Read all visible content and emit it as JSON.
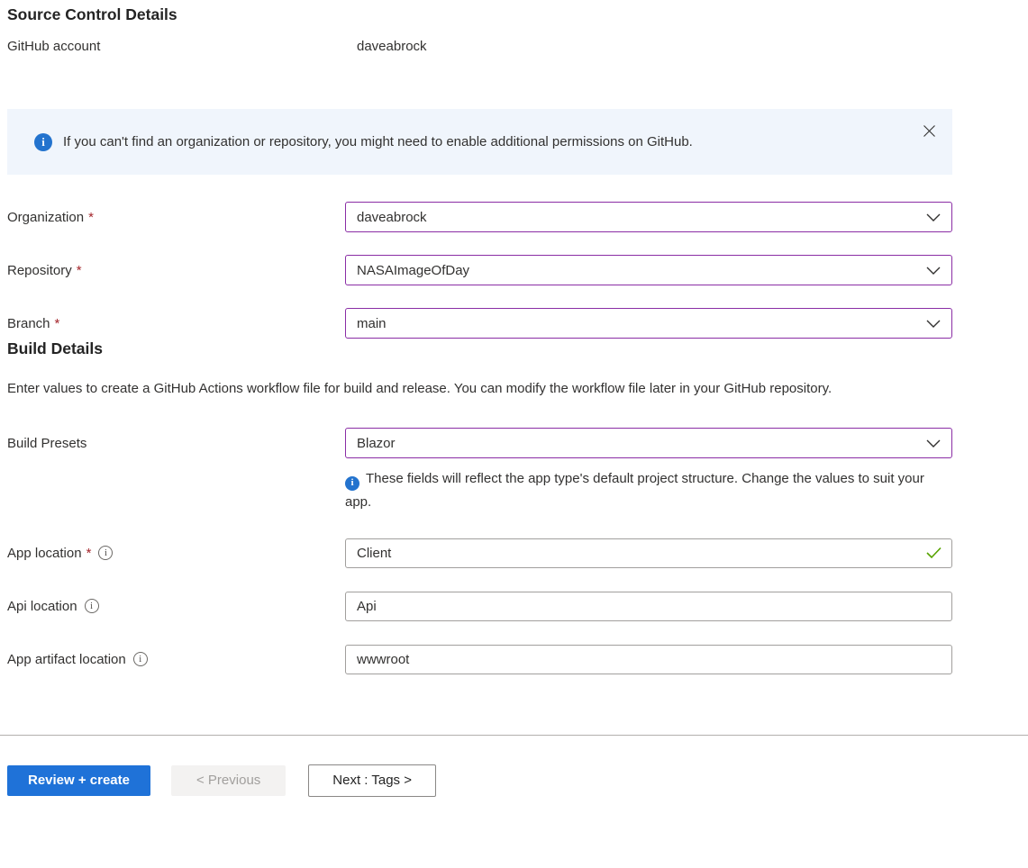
{
  "headings": {
    "source_control": "Source Control Details",
    "build_details": "Build Details"
  },
  "github_account": {
    "label": "GitHub account",
    "value": "daveabrock"
  },
  "banner": {
    "text": "If you can't find an organization or repository, you might need to enable additional permissions on GitHub."
  },
  "build_description": "Enter values to create a GitHub Actions workflow file for build and release. You can modify the workflow file later in your GitHub repository.",
  "form": {
    "organization": {
      "label": "Organization",
      "required_mark": "*",
      "value": "daveabrock"
    },
    "repository": {
      "label": "Repository",
      "required_mark": "*",
      "value": "NASAImageOfDay"
    },
    "branch": {
      "label": "Branch",
      "required_mark": "*",
      "value": "main"
    },
    "build_presets": {
      "label": "Build Presets",
      "value": "Blazor",
      "note": "These fields will reflect the app type's default project structure. Change the values to suit your app."
    },
    "app_location": {
      "label": "App location",
      "required_mark": "*",
      "value": "Client"
    },
    "api_location": {
      "label": "Api location",
      "value": "Api"
    },
    "app_artifact_location": {
      "label": "App artifact location",
      "value": "wwwroot"
    }
  },
  "footer": {
    "review_create_label": "Review + create",
    "previous_label": "< Previous",
    "next_label": "Next : Tags >"
  },
  "icons": {
    "banner_info": "info-icon",
    "banner_close": "close-icon",
    "dropdown_chevron": "chevron-down-icon",
    "field_info": "info-icon",
    "valid_check": "checkmark-icon"
  },
  "colors": {
    "dropdown_border": "#8A2DA5",
    "primary_button_blue": "#1F72D8",
    "banner_background": "#F0F5FC",
    "info_icon_blue": "#2373CE",
    "required_red": "#A4262C",
    "valid_green": "#57A300"
  }
}
